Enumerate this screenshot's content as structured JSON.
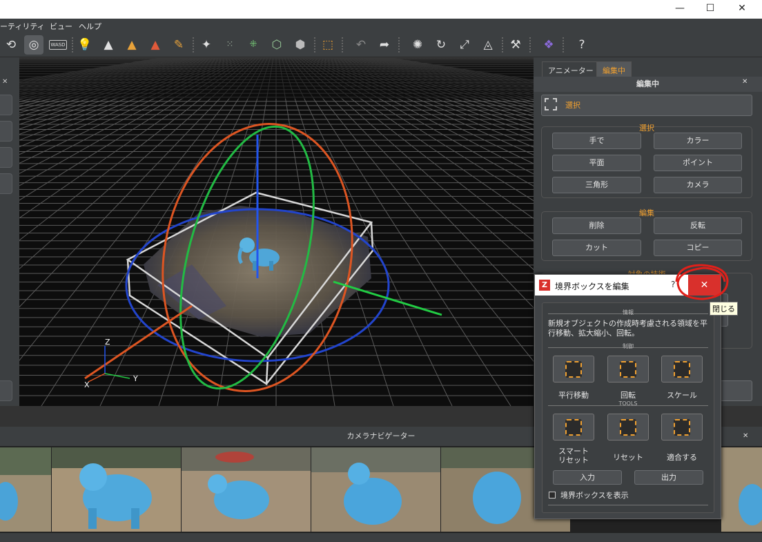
{
  "titlebar": {
    "minimize": "—",
    "maximize": "☐",
    "close": "✕"
  },
  "menu": [
    "ーティリティ",
    "ビュー",
    "ヘルプ"
  ],
  "toolbar": {
    "wasd": "WASD",
    "help": "?"
  },
  "right_panel": {
    "tabs": [
      "アニメーター",
      "編集中"
    ],
    "header": "編集中",
    "mode_button": "選択",
    "select_group": {
      "label": "選択",
      "buttons": [
        "手で",
        "カラー",
        "平面",
        "ポイント",
        "三角形",
        "カメラ"
      ]
    },
    "edit_group": {
      "label": "編集",
      "buttons": [
        "削除",
        "反転",
        "カット",
        "コピー"
      ]
    },
    "object_group_label": "対象の技術"
  },
  "axes": {
    "z": "Z",
    "y": "Y",
    "x": "X"
  },
  "camera_navigator": {
    "title": "カメラナビゲーター"
  },
  "dialog": {
    "title": "境界ボックスを編集",
    "help": "?",
    "close_tooltip": "閉じる",
    "info_section": "情報",
    "info_text": "新規オブジェクトの作成時考慮される領域を平行移動、拡大縮小、回転。",
    "control_section": "制御",
    "control_buttons": [
      "平行移動",
      "回転",
      "スケール"
    ],
    "tools_section": "TOOLS",
    "tool_buttons": [
      "スマート\nリセット",
      "リセット",
      "適合する"
    ],
    "input_button": "入力",
    "output_button": "出力",
    "show_box_label": "境界ボックスを表示",
    "show_box_checked": false
  },
  "colors": {
    "accent": "#f0a030",
    "close_red": "#d9302c",
    "annotation": "#e0201a"
  }
}
